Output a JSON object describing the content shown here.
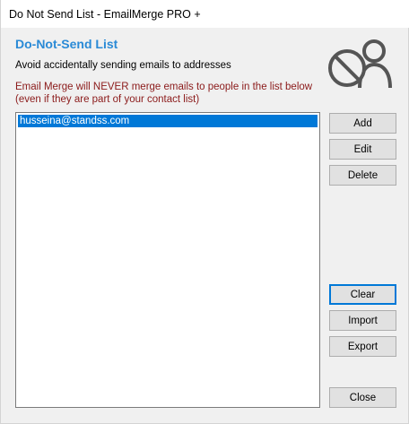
{
  "window": {
    "title": "Do Not Send List - EmailMerge PRO +"
  },
  "header": {
    "heading": "Do-Not-Send List",
    "subheading": "Avoid accidentally sending emails to addresses",
    "warning_line1": "Email Merge will NEVER merge emails to people in the list below",
    "warning_line2": "(even if they are part of your contact list)",
    "icon": "blocked-user-icon"
  },
  "list": {
    "items": [
      {
        "label": "husseina@standss.com",
        "selected": true
      }
    ]
  },
  "buttons": {
    "add": "Add",
    "edit": "Edit",
    "delete": "Delete",
    "clear": "Clear",
    "import": "Import",
    "export": "Export",
    "close": "Close"
  },
  "colors": {
    "heading": "#2a8ad6",
    "warning": "#8b1a1a",
    "selection": "#0078d7",
    "focus": "#0078d7"
  }
}
